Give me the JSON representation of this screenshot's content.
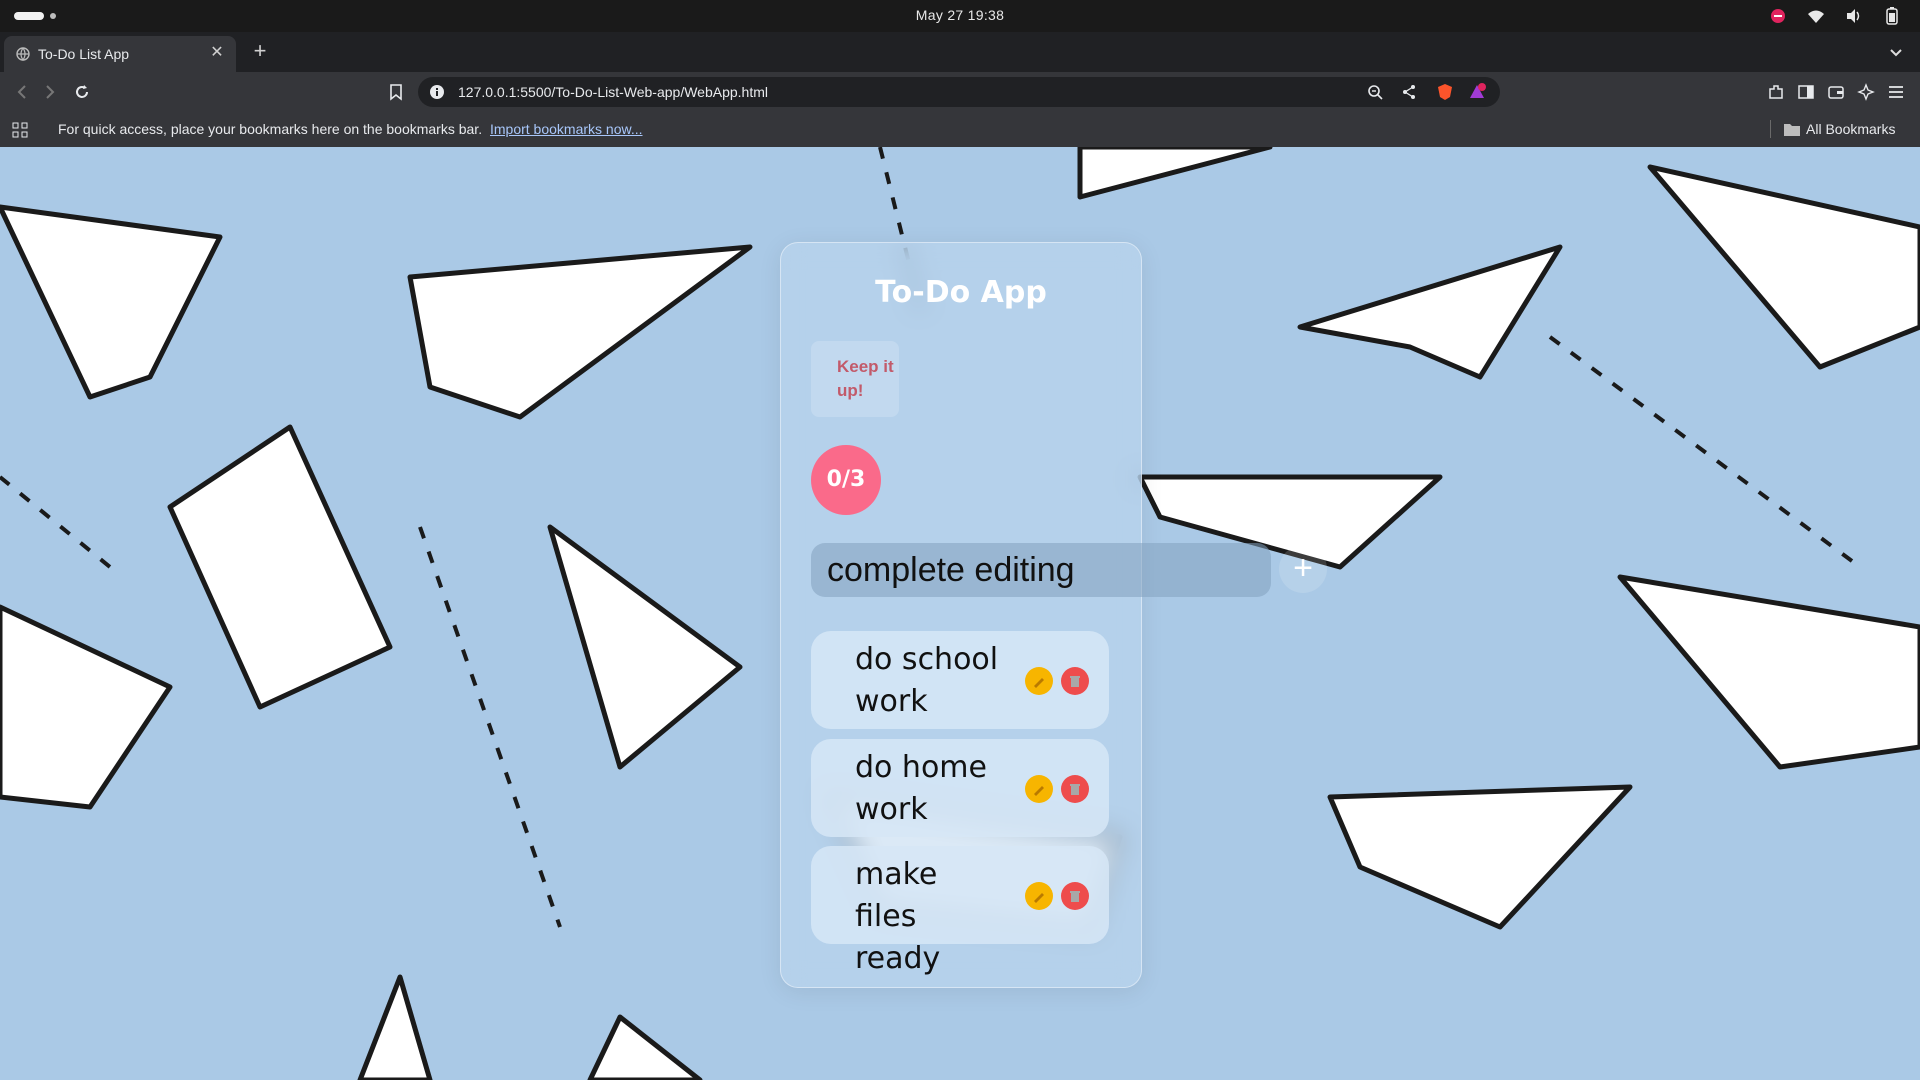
{
  "os": {
    "clock": "May 27  19:38"
  },
  "browser": {
    "tab_title": "To-Do List App",
    "url": "127.0.0.1:5500/To-Do-List-Web-app/WebApp.html",
    "bookmarks_prompt": "For quick access, place your bookmarks here on the bookmarks bar.",
    "bookmarks_link": "Import bookmarks now...",
    "all_bookmarks": "All Bookmarks",
    "notification_badge": "1"
  },
  "app": {
    "title": "To-Do App",
    "motto": "Keep it up!",
    "progress": "0/3",
    "input_value": "complete editing",
    "add_label": "+",
    "tasks": [
      {
        "text": "do school work"
      },
      {
        "text": "do home work"
      },
      {
        "text": "make files ready"
      }
    ],
    "colors": {
      "counter": "#fa6a8a",
      "edit": "#f7b500",
      "delete": "#ee4c4c",
      "background": "#aac9e6"
    }
  }
}
